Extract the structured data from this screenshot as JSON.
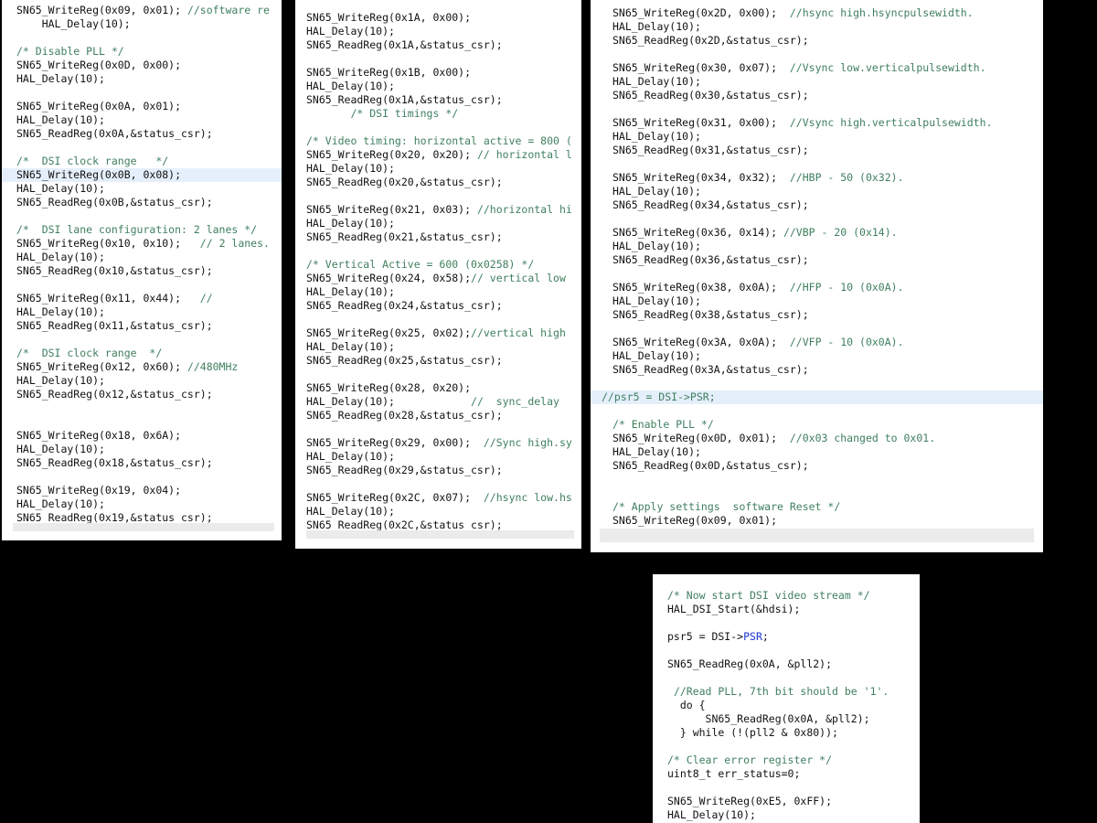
{
  "panels": [
    {
      "name": "panel-1",
      "lines": [
        {
          "code": "SN65_WriteReg(0x09, 0x01); ",
          "comment": "//software re"
        },
        {
          "code": "    HAL_Delay(10);"
        },
        {
          "code": ""
        },
        {
          "code": "",
          "comment": "/* Disable PLL */"
        },
        {
          "code": "SN65_WriteReg(0x0D, 0x00);"
        },
        {
          "code": "HAL_Delay(10);"
        },
        {
          "code": ""
        },
        {
          "code": "SN65_WriteReg(0x0A, 0x01);"
        },
        {
          "code": "HAL_Delay(10);"
        },
        {
          "code": "SN65_ReadReg(0x0A,&status_csr);"
        },
        {
          "code": ""
        },
        {
          "code": "",
          "comment": "/*  DSI clock range   */"
        },
        {
          "code": "SN65_WriteReg(0x0B, 0x08);",
          "highlight": true
        },
        {
          "code": "HAL_Delay(10);"
        },
        {
          "code": "SN65_ReadReg(0x0B,&status_csr);"
        },
        {
          "code": ""
        },
        {
          "code": "",
          "comment": "/*  DSI lane configuration: 2 lanes */"
        },
        {
          "code": "SN65_WriteReg(0x10, 0x10);   ",
          "comment": "// 2 lanes."
        },
        {
          "code": "HAL_Delay(10);"
        },
        {
          "code": "SN65_ReadReg(0x10,&status_csr);"
        },
        {
          "code": ""
        },
        {
          "code": "SN65_WriteReg(0x11, 0x44);   ",
          "comment": "//"
        },
        {
          "code": "HAL_Delay(10);"
        },
        {
          "code": "SN65_ReadReg(0x11,&status_csr);"
        },
        {
          "code": ""
        },
        {
          "code": "",
          "comment": "/*  DSI clock range  */"
        },
        {
          "code": "SN65_WriteReg(0x12, 0x60); ",
          "comment": "//480MHz"
        },
        {
          "code": "HAL_Delay(10);"
        },
        {
          "code": "SN65_ReadReg(0x12,&status_csr);"
        },
        {
          "code": ""
        },
        {
          "code": ""
        },
        {
          "code": "SN65_WriteReg(0x18, 0x6A);"
        },
        {
          "code": "HAL_Delay(10);"
        },
        {
          "code": "SN65_ReadReg(0x18,&status_csr);"
        },
        {
          "code": ""
        },
        {
          "code": "SN65_WriteReg(0x19, 0x04);"
        },
        {
          "code": "HAL_Delay(10);"
        },
        {
          "code": "SN65_ReadReg(0x19,&status_csr);"
        }
      ]
    },
    {
      "name": "panel-2",
      "lines": [
        {
          "code": ""
        },
        {
          "code": "SN65_WriteReg(0x1A, 0x00);"
        },
        {
          "code": "HAL_Delay(10);"
        },
        {
          "code": "SN65_ReadReg(0x1A,&status_csr);"
        },
        {
          "code": ""
        },
        {
          "code": "SN65_WriteReg(0x1B, 0x00);"
        },
        {
          "code": "HAL_Delay(10);"
        },
        {
          "code": "SN65_ReadReg(0x1A,&status_csr);"
        },
        {
          "code": "       ",
          "comment": "/* DSI timings */"
        },
        {
          "code": ""
        },
        {
          "code": "",
          "comment": "/* Video timing: horizontal active = 800 ("
        },
        {
          "code": "SN65_WriteReg(0x20, 0x20); ",
          "comment": "// horizontal l"
        },
        {
          "code": "HAL_Delay(10);"
        },
        {
          "code": "SN65_ReadReg(0x20,&status_csr);"
        },
        {
          "code": ""
        },
        {
          "code": "SN65_WriteReg(0x21, 0x03); ",
          "comment": "//horizontal hi"
        },
        {
          "code": "HAL_Delay(10);"
        },
        {
          "code": "SN65_ReadReg(0x21,&status_csr);"
        },
        {
          "code": ""
        },
        {
          "code": "",
          "comment": "/* Vertical Active = 600 (0x0258) */"
        },
        {
          "code": "SN65_WriteReg(0x24, 0x58);",
          "comment": "// vertical low"
        },
        {
          "code": "HAL_Delay(10);"
        },
        {
          "code": "SN65_ReadReg(0x24,&status_csr);"
        },
        {
          "code": ""
        },
        {
          "code": "SN65_WriteReg(0x25, 0x02);",
          "comment": "//vertical high"
        },
        {
          "code": "HAL_Delay(10);"
        },
        {
          "code": "SN65_ReadReg(0x25,&status_csr);"
        },
        {
          "code": ""
        },
        {
          "code": "SN65_WriteReg(0x28, 0x20);"
        },
        {
          "code": "HAL_Delay(10);            ",
          "comment": "//  sync_delay"
        },
        {
          "code": "SN65_ReadReg(0x28,&status_csr);"
        },
        {
          "code": ""
        },
        {
          "code": "SN65_WriteReg(0x29, 0x00);  ",
          "comment": "//Sync high.sy"
        },
        {
          "code": "HAL_Delay(10);"
        },
        {
          "code": "SN65_ReadReg(0x29,&status_csr);"
        },
        {
          "code": ""
        },
        {
          "code": "SN65_WriteReg(0x2C, 0x07);  ",
          "comment": "//hsync low.hs"
        },
        {
          "code": "HAL_Delay(10);"
        },
        {
          "code": "SN65_ReadReg(0x2C,&status_csr);"
        }
      ]
    },
    {
      "name": "panel-3",
      "lines": [
        {
          "code": "SN65_WriteReg(0x2D, 0x00);  ",
          "comment": "//hsync high.hsyncpulsewidth."
        },
        {
          "code": "HAL_Delay(10);"
        },
        {
          "code": "SN65_ReadReg(0x2D,&status_csr);"
        },
        {
          "code": ""
        },
        {
          "code": "SN65_WriteReg(0x30, 0x07);  ",
          "comment": "//Vsync low.verticalpulsewidth."
        },
        {
          "code": "HAL_Delay(10);"
        },
        {
          "code": "SN65_ReadReg(0x30,&status_csr);"
        },
        {
          "code": ""
        },
        {
          "code": "SN65_WriteReg(0x31, 0x00);  ",
          "comment": "//Vsync high.verticalpulsewidth."
        },
        {
          "code": "HAL_Delay(10);"
        },
        {
          "code": "SN65_ReadReg(0x31,&status_csr);"
        },
        {
          "code": ""
        },
        {
          "code": "SN65_WriteReg(0x34, 0x32);  ",
          "comment": "//HBP - 50 (0x32)."
        },
        {
          "code": "HAL_Delay(10);"
        },
        {
          "code": "SN65_ReadReg(0x34,&status_csr);"
        },
        {
          "code": ""
        },
        {
          "code": "SN65_WriteReg(0x36, 0x14); ",
          "comment": "//VBP - 20 (0x14)."
        },
        {
          "code": "HAL_Delay(10);"
        },
        {
          "code": "SN65_ReadReg(0x36,&status_csr);"
        },
        {
          "code": ""
        },
        {
          "code": "SN65_WriteReg(0x38, 0x0A);  ",
          "comment": "//HFP - 10 (0x0A)."
        },
        {
          "code": "HAL_Delay(10);"
        },
        {
          "code": "SN65_ReadReg(0x38,&status_csr);"
        },
        {
          "code": ""
        },
        {
          "code": "SN65_WriteReg(0x3A, 0x0A);  ",
          "comment": "//VFP - 10 (0x0A)."
        },
        {
          "code": "HAL_Delay(10);"
        },
        {
          "code": "SN65_ReadReg(0x3A,&status_csr);"
        },
        {
          "code": ""
        },
        {
          "code": "",
          "comment": "//psr5 = DSI->PSR;",
          "highlight": true,
          "outdent": true
        },
        {
          "code": ""
        },
        {
          "code": "",
          "comment": "/* Enable PLL */"
        },
        {
          "code": "SN65_WriteReg(0x0D, 0x01);  ",
          "comment": "//0x03 changed to 0x01."
        },
        {
          "code": "HAL_Delay(10);"
        },
        {
          "code": "SN65_ReadReg(0x0D,&status_csr);"
        },
        {
          "code": ""
        },
        {
          "code": ""
        },
        {
          "code": "",
          "comment": "/* Apply settings  software Reset */"
        },
        {
          "code": "SN65_WriteReg(0x09, 0x01);"
        }
      ]
    },
    {
      "name": "panel-4",
      "lines": [
        {
          "code": "",
          "comment": "/* Now start DSI video stream */"
        },
        {
          "code": "HAL_DSI_Start(&hdsi);"
        },
        {
          "code": ""
        },
        {
          "code": "psr5 = DSI->",
          "keyword": "PSR",
          "tail": ";"
        },
        {
          "code": ""
        },
        {
          "code": "SN65_ReadReg(0x0A, &pll2);"
        },
        {
          "code": ""
        },
        {
          "code": " ",
          "comment": "//Read PLL, 7th bit should be '1'."
        },
        {
          "code": "  do {"
        },
        {
          "code": "      SN65_ReadReg(0x0A, &pll2);"
        },
        {
          "code": "  } while (!(pll2 & 0x80));"
        },
        {
          "code": ""
        },
        {
          "code": "",
          "comment": "/* Clear error register */"
        },
        {
          "code": "uint8_t err_status=0;"
        },
        {
          "code": ""
        },
        {
          "code": "SN65_WriteReg(0xE5, 0xFF);"
        },
        {
          "code": "HAL_Delay(10);"
        }
      ]
    }
  ]
}
